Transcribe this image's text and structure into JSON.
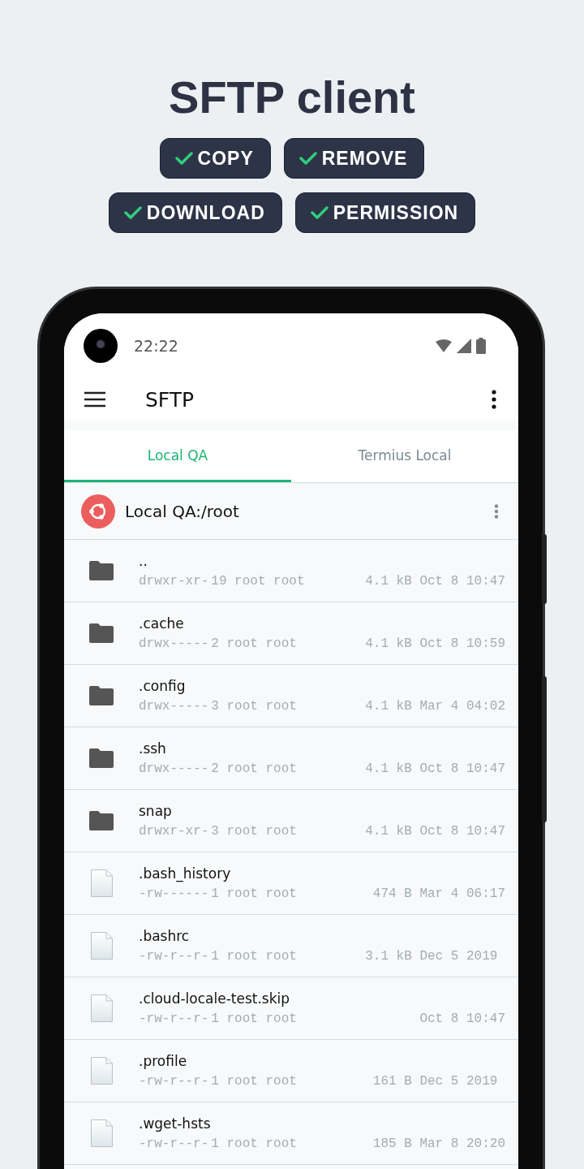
{
  "headline": "SFTP client",
  "features": [
    {
      "label": "COPY"
    },
    {
      "label": "REMOVE"
    },
    {
      "label": "DOWNLOAD"
    },
    {
      "label": "PERMISSION"
    }
  ],
  "status_bar": {
    "time": "22:22"
  },
  "app_bar": {
    "title": "SFTP"
  },
  "tabs": [
    {
      "label": "Local QA",
      "selected": true
    },
    {
      "label": "Termius Local",
      "selected": false
    }
  ],
  "path": {
    "title": "Local QA:/root"
  },
  "files": [
    {
      "kind": "folder",
      "name": "..",
      "perms": "drwxr-xr-",
      "links": "19 root root",
      "size": "4.1 kB",
      "date": "Oct 8 10:47"
    },
    {
      "kind": "folder",
      "name": ".cache",
      "perms": "drwx-----",
      "links": "2 root root",
      "size": "4.1 kB",
      "date": "Oct 8 10:59"
    },
    {
      "kind": "folder",
      "name": ".config",
      "perms": "drwx-----",
      "links": "3 root root",
      "size": "4.1 kB",
      "date": "Mar 4 04:02"
    },
    {
      "kind": "folder",
      "name": ".ssh",
      "perms": "drwx-----",
      "links": "2 root root",
      "size": "4.1 kB",
      "date": "Oct 8 10:47"
    },
    {
      "kind": "folder",
      "name": "snap",
      "perms": "drwxr-xr-",
      "links": "3 root root",
      "size": "4.1 kB",
      "date": "Oct 8 10:47"
    },
    {
      "kind": "file",
      "name": ".bash_history",
      "perms": "-rw------",
      "links": "1 root root",
      "size": "474 B",
      "date": "Mar 4 06:17"
    },
    {
      "kind": "file",
      "name": ".bashrc",
      "perms": "-rw-r--r-",
      "links": "1 root root",
      "size": "3.1 kB",
      "date": "Dec 5 2019"
    },
    {
      "kind": "file",
      "name": ".cloud-locale-test.skip",
      "perms": "-rw-r--r-",
      "links": "1 root root",
      "date": "Oct 8 10:47"
    },
    {
      "kind": "file",
      "name": ".profile",
      "perms": "-rw-r--r-",
      "links": "1 root root",
      "size": "161 B",
      "date": "Dec 5 2019"
    },
    {
      "kind": "file",
      "name": ".wget-hsts",
      "perms": "-rw-r--r-",
      "links": "1 root root",
      "size": "185 B",
      "date": "Mar 8 20:20"
    }
  ]
}
